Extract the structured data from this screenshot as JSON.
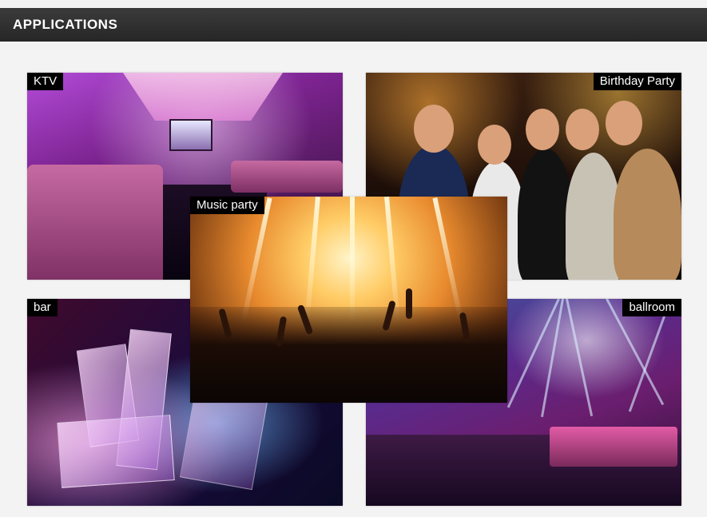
{
  "header": {
    "title": "APPLICATIONS"
  },
  "panels": {
    "ktv": {
      "label": "KTV"
    },
    "birthday": {
      "label": "Birthday Party"
    },
    "bar": {
      "label": "bar"
    },
    "ballroom": {
      "label": "ballroom"
    },
    "music": {
      "label": "Music party"
    }
  },
  "colors": {
    "header_bg": "#2f2f2f",
    "header_text": "#ffffff",
    "label_bg": "#000000",
    "label_text": "#ffffff",
    "page_bg": "#f3f3f3"
  }
}
